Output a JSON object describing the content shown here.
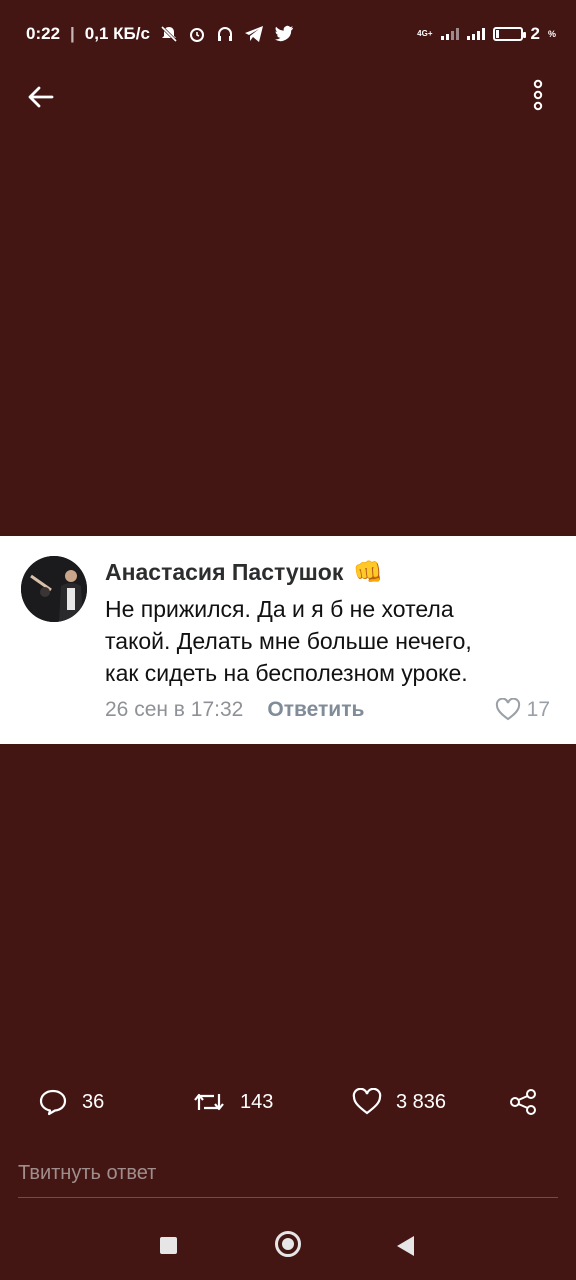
{
  "status_bar": {
    "time": "0:22",
    "net_speed": "0,1 КБ/с",
    "network_type": "4G+",
    "battery": "2",
    "battery_unit": "%",
    "icons": [
      "mute-icon",
      "alarm-icon",
      "headphones-icon",
      "telegram-icon",
      "twitter-icon"
    ]
  },
  "comment": {
    "author": "Анастасия Пастушок",
    "emoji": "👊",
    "text_lines": [
      "Не прижился. Да и я б не хотела",
      "такой. Делать мне больше нечего,",
      "как сидеть на бесполезном уроке."
    ],
    "date": "26 сен в 17:32",
    "reply_label": "Ответить",
    "likes": "17"
  },
  "actions": {
    "replies": "36",
    "retweets": "143",
    "likes": "3 836"
  },
  "reply_field": {
    "placeholder": "Твитнуть ответ"
  },
  "colors": {
    "background": "#431614",
    "card": "#ffffff",
    "meta_text": "#8e9196"
  }
}
